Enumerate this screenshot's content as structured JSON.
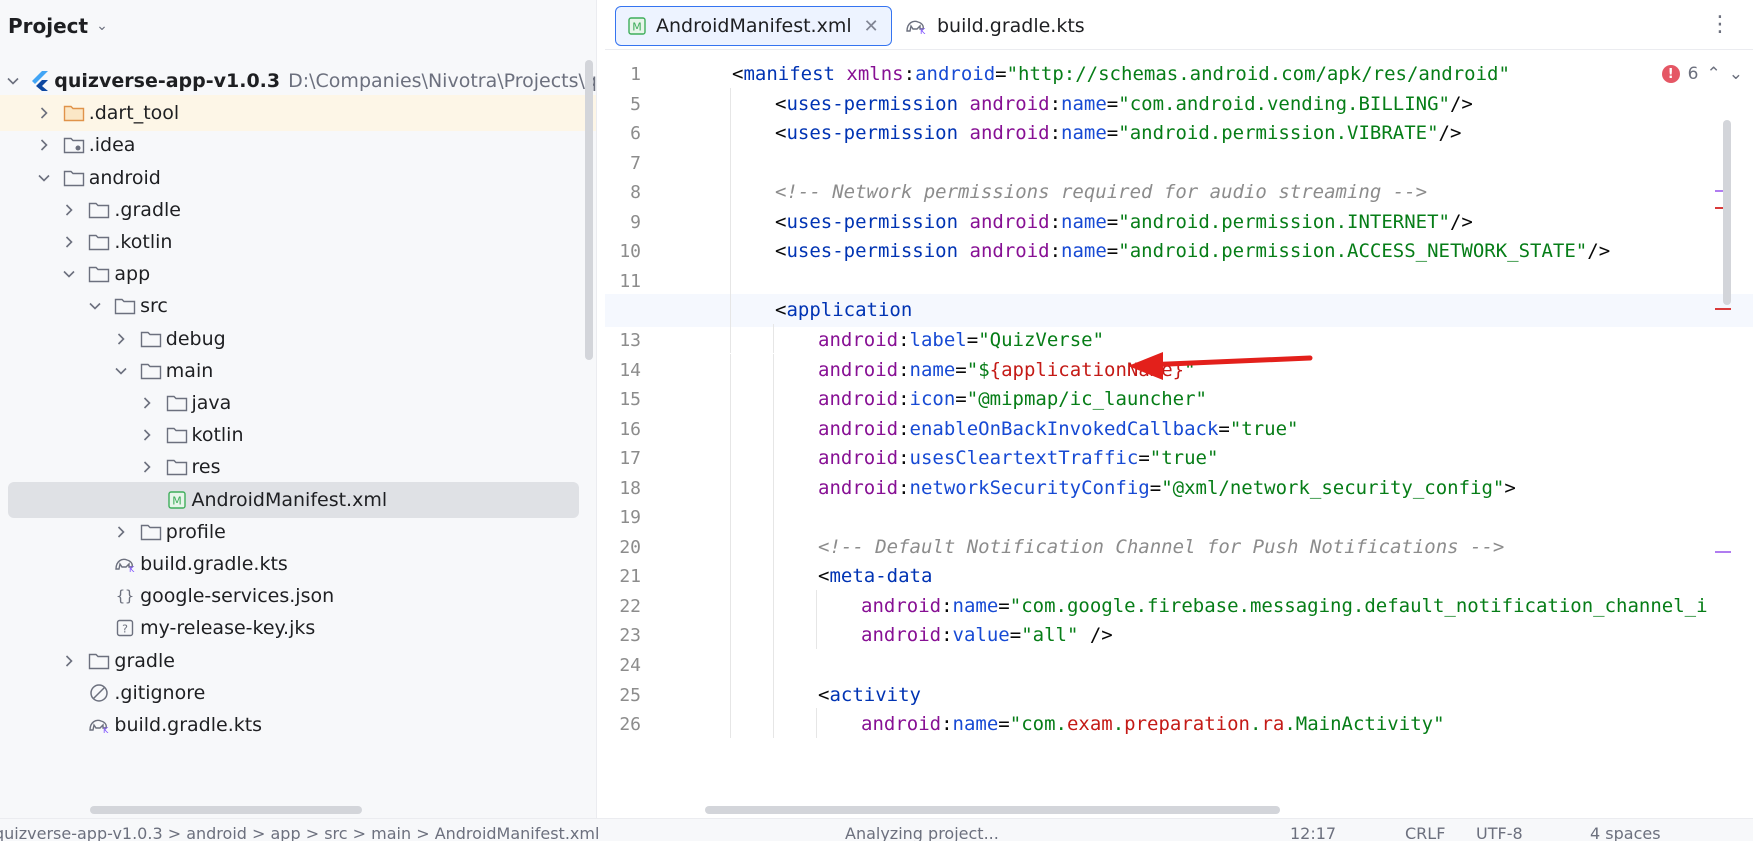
{
  "project_panel": {
    "title": "Project",
    "tree": [
      {
        "label": "quizverse-app-v1.0.3",
        "path": "D:\\Companies\\Nivotra\\Projects\\q",
        "depth": 0,
        "state": "expanded",
        "icon": "flutter-icon",
        "bold": true
      },
      {
        "label": ".dart_tool",
        "depth": 1,
        "state": "collapsed",
        "icon": "folder-orange-icon",
        "hover": true
      },
      {
        "label": ".idea",
        "depth": 1,
        "state": "collapsed",
        "icon": "folder-settings-icon"
      },
      {
        "label": "android",
        "depth": 1,
        "state": "expanded",
        "icon": "folder-icon"
      },
      {
        "label": ".gradle",
        "depth": 2,
        "state": "collapsed",
        "icon": "folder-icon"
      },
      {
        "label": ".kotlin",
        "depth": 2,
        "state": "collapsed",
        "icon": "folder-icon"
      },
      {
        "label": "app",
        "depth": 2,
        "state": "expanded",
        "icon": "folder-icon"
      },
      {
        "label": "src",
        "depth": 3,
        "state": "expanded",
        "icon": "folder-icon"
      },
      {
        "label": "debug",
        "depth": 4,
        "state": "collapsed",
        "icon": "folder-icon"
      },
      {
        "label": "main",
        "depth": 4,
        "state": "expanded",
        "icon": "folder-icon"
      },
      {
        "label": "java",
        "depth": 5,
        "state": "collapsed",
        "icon": "folder-icon"
      },
      {
        "label": "kotlin",
        "depth": 5,
        "state": "collapsed",
        "icon": "folder-icon"
      },
      {
        "label": "res",
        "depth": 5,
        "state": "collapsed",
        "icon": "folder-icon"
      },
      {
        "label": "AndroidManifest.xml",
        "depth": 5,
        "state": "leaf",
        "icon": "manifest-file-icon",
        "selected": true
      },
      {
        "label": "profile",
        "depth": 4,
        "state": "collapsed",
        "icon": "folder-icon"
      },
      {
        "label": "build.gradle.kts",
        "depth": 3,
        "state": "leaf",
        "icon": "gradle-file-icon"
      },
      {
        "label": "google-services.json",
        "depth": 3,
        "state": "leaf",
        "icon": "json-file-icon"
      },
      {
        "label": "my-release-key.jks",
        "depth": 3,
        "state": "leaf",
        "icon": "unknown-file-icon"
      },
      {
        "label": "gradle",
        "depth": 2,
        "state": "collapsed",
        "icon": "folder-icon"
      },
      {
        "label": ".gitignore",
        "depth": 2,
        "state": "leaf",
        "icon": "gitignore-file-icon"
      },
      {
        "label": "build.gradle.kts",
        "depth": 2,
        "state": "leaf",
        "icon": "gradle-file-icon"
      }
    ]
  },
  "editor": {
    "tabs": [
      {
        "label": "AndroidManifest.xml",
        "icon": "manifest-file-icon",
        "active": true,
        "closable": true
      },
      {
        "label": "build.gradle.kts",
        "icon": "gradle-file-icon",
        "active": false,
        "closable": false
      }
    ],
    "problems_count": "6",
    "current_line": "12",
    "lines": [
      {
        "num": "1",
        "indent": 0,
        "tokens": [
          [
            "pun",
            "<"
          ],
          [
            "tag",
            "manifest"
          ],
          [
            "pun",
            " "
          ],
          [
            "ns",
            "xmlns"
          ],
          [
            "pun",
            ":"
          ],
          [
            "attr",
            "android"
          ],
          [
            "pun",
            "="
          ],
          [
            "str",
            "\"http://schemas.android.com/apk/res/android\""
          ]
        ]
      },
      {
        "num": "5",
        "indent": 1,
        "tokens": [
          [
            "pun",
            "<"
          ],
          [
            "tag",
            "uses-permission"
          ],
          [
            "pun",
            " "
          ],
          [
            "ns",
            "android"
          ],
          [
            "pun",
            ":"
          ],
          [
            "attr",
            "name"
          ],
          [
            "pun",
            "="
          ],
          [
            "str",
            "\"com.android.vending.BILLING\""
          ],
          [
            "pun",
            "/>"
          ]
        ]
      },
      {
        "num": "6",
        "indent": 1,
        "tokens": [
          [
            "pun",
            "<"
          ],
          [
            "tag",
            "uses-permission"
          ],
          [
            "pun",
            " "
          ],
          [
            "ns",
            "android"
          ],
          [
            "pun",
            ":"
          ],
          [
            "attr",
            "name"
          ],
          [
            "pun",
            "="
          ],
          [
            "str",
            "\"android.permission.VIBRATE\""
          ],
          [
            "pun",
            "/>"
          ]
        ]
      },
      {
        "num": "7",
        "indent": 1,
        "tokens": []
      },
      {
        "num": "8",
        "indent": 1,
        "tokens": [
          [
            "cmt",
            "<!-- Network permissions required for audio streaming -->"
          ]
        ]
      },
      {
        "num": "9",
        "indent": 1,
        "tokens": [
          [
            "pun",
            "<"
          ],
          [
            "tag",
            "uses-permission"
          ],
          [
            "pun",
            " "
          ],
          [
            "ns",
            "android"
          ],
          [
            "pun",
            ":"
          ],
          [
            "attr",
            "name"
          ],
          [
            "pun",
            "="
          ],
          [
            "str",
            "\"android.permission.INTERNET\""
          ],
          [
            "pun",
            "/>"
          ]
        ]
      },
      {
        "num": "10",
        "indent": 1,
        "tokens": [
          [
            "pun",
            "<"
          ],
          [
            "tag",
            "uses-permission"
          ],
          [
            "pun",
            " "
          ],
          [
            "ns",
            "android"
          ],
          [
            "pun",
            ":"
          ],
          [
            "attr",
            "name"
          ],
          [
            "pun",
            "="
          ],
          [
            "str",
            "\"android.permission.ACCESS_NETWORK_STATE\""
          ],
          [
            "pun",
            "/>"
          ]
        ]
      },
      {
        "num": "11",
        "indent": 1,
        "tokens": []
      },
      {
        "num": "12",
        "indent": 1,
        "tokens": [
          [
            "pun",
            "<"
          ],
          [
            "tag",
            "application"
          ]
        ]
      },
      {
        "num": "13",
        "indent": 2,
        "tokens": [
          [
            "ns",
            "android"
          ],
          [
            "pun",
            ":"
          ],
          [
            "attr",
            "label"
          ],
          [
            "pun",
            "="
          ],
          [
            "str",
            "\"QuizVerse\""
          ]
        ]
      },
      {
        "num": "14",
        "indent": 2,
        "tokens": [
          [
            "ns",
            "android"
          ],
          [
            "pun",
            ":"
          ],
          [
            "attr",
            "name"
          ],
          [
            "pun",
            "="
          ],
          [
            "str",
            "\"$"
          ],
          [
            "var",
            "{applicationName}"
          ],
          [
            "str",
            "\""
          ]
        ]
      },
      {
        "num": "15",
        "indent": 2,
        "tokens": [
          [
            "ns",
            "android"
          ],
          [
            "pun",
            ":"
          ],
          [
            "attr",
            "icon"
          ],
          [
            "pun",
            "="
          ],
          [
            "str",
            "\"@mipmap/ic_launcher\""
          ]
        ]
      },
      {
        "num": "16",
        "indent": 2,
        "tokens": [
          [
            "ns",
            "android"
          ],
          [
            "pun",
            ":"
          ],
          [
            "attr",
            "enableOnBackInvokedCallback"
          ],
          [
            "pun",
            "="
          ],
          [
            "str",
            "\"true\""
          ]
        ]
      },
      {
        "num": "17",
        "indent": 2,
        "tokens": [
          [
            "ns",
            "android"
          ],
          [
            "pun",
            ":"
          ],
          [
            "attr",
            "usesCleartextTraffic"
          ],
          [
            "pun",
            "="
          ],
          [
            "str",
            "\"true\""
          ]
        ]
      },
      {
        "num": "18",
        "indent": 2,
        "tokens": [
          [
            "ns",
            "android"
          ],
          [
            "pun",
            ":"
          ],
          [
            "attr",
            "networkSecurityConfig"
          ],
          [
            "pun",
            "="
          ],
          [
            "str",
            "\"@xml/network_security_config\""
          ],
          [
            "pun",
            ">"
          ]
        ]
      },
      {
        "num": "19",
        "indent": 2,
        "tokens": []
      },
      {
        "num": "20",
        "indent": 2,
        "tokens": [
          [
            "cmt",
            "<!-- Default Notification Channel for Push Notifications -->"
          ]
        ]
      },
      {
        "num": "21",
        "indent": 2,
        "tokens": [
          [
            "pun",
            "<"
          ],
          [
            "tag",
            "meta-data"
          ]
        ]
      },
      {
        "num": "22",
        "indent": 3,
        "tokens": [
          [
            "ns",
            "android"
          ],
          [
            "pun",
            ":"
          ],
          [
            "attr",
            "name"
          ],
          [
            "pun",
            "="
          ],
          [
            "str",
            "\"com.google.firebase.messaging.default_notification_channel_i"
          ]
        ]
      },
      {
        "num": "23",
        "indent": 3,
        "tokens": [
          [
            "ns",
            "android"
          ],
          [
            "pun",
            ":"
          ],
          [
            "attr",
            "value"
          ],
          [
            "pun",
            "="
          ],
          [
            "str",
            "\"all\""
          ],
          [
            "pun",
            " />"
          ]
        ]
      },
      {
        "num": "24",
        "indent": 2,
        "tokens": []
      },
      {
        "num": "25",
        "indent": 2,
        "tokens": [
          [
            "pun",
            "<"
          ],
          [
            "tag",
            "activity"
          ]
        ]
      },
      {
        "num": "26",
        "indent": 3,
        "tokens": [
          [
            "ns",
            "android"
          ],
          [
            "pun",
            ":"
          ],
          [
            "attr",
            "name"
          ],
          [
            "pun",
            "="
          ],
          [
            "str",
            "\"com."
          ],
          [
            "var",
            "exam"
          ],
          [
            "str",
            "."
          ],
          [
            "var",
            "preparation"
          ],
          [
            "str",
            "."
          ],
          [
            "var",
            "ra"
          ],
          [
            "str",
            ".MainActivity\""
          ]
        ]
      }
    ]
  },
  "status_bar": {
    "breadcrumb": "quizverse-app-v1.0.3  >  android  >  app  >  src  >  main  >  AndroidManifest.xml",
    "status": "Analyzing project...",
    "position": "12:17",
    "line_sep": "CRLF",
    "encoding": "UTF-8",
    "indent": "4 spaces"
  },
  "colors": {
    "annotation_arrow": "#e3201b",
    "selection": "#dfe1e5",
    "accent": "#3574f0",
    "error": "#e55765"
  }
}
